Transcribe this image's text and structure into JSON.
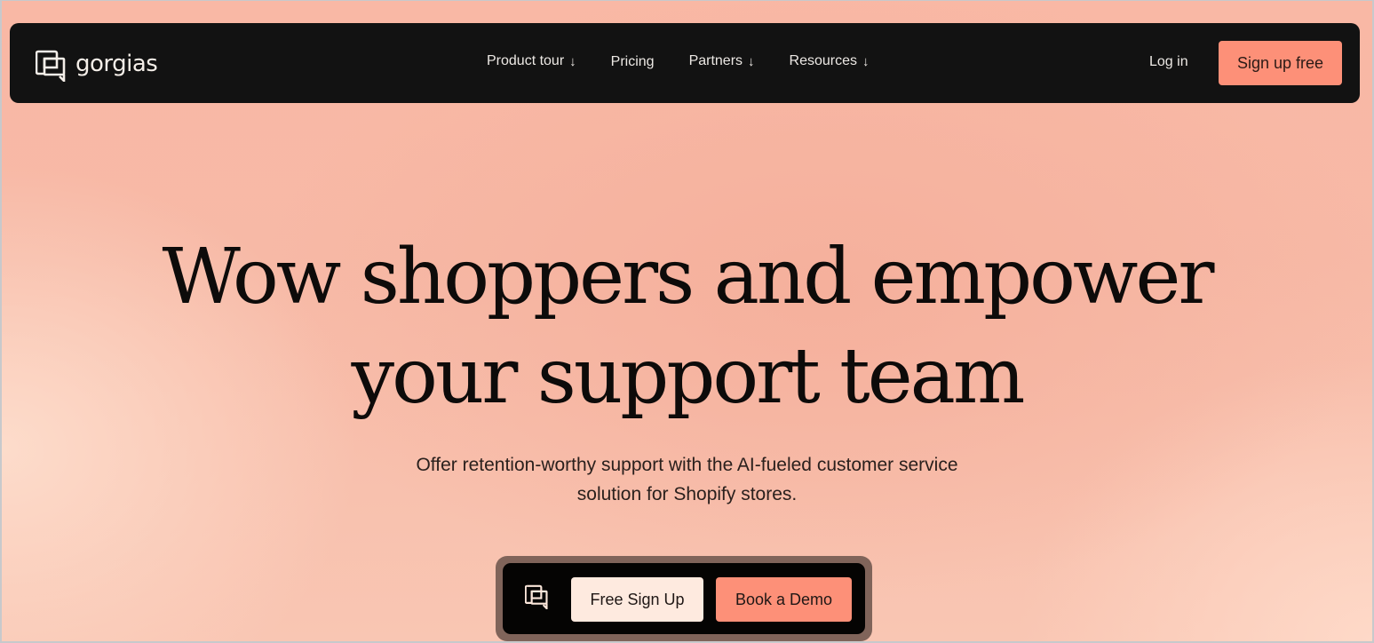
{
  "brand": {
    "name": "gorgias",
    "logo_icon": "gorgias-logo-icon"
  },
  "nav": {
    "items": [
      {
        "label": "Product tour",
        "has_dropdown": true,
        "icon": "arrow-down-icon",
        "arrow": "↓"
      },
      {
        "label": "Pricing",
        "has_dropdown": false
      },
      {
        "label": "Partners",
        "has_dropdown": true,
        "icon": "arrow-down-icon",
        "arrow": "↓"
      },
      {
        "label": "Resources",
        "has_dropdown": true,
        "icon": "arrow-down-icon",
        "arrow": "↓"
      }
    ],
    "login_label": "Log in",
    "signup_label": "Sign up free"
  },
  "hero": {
    "title_line1": "Wow shoppers and empower",
    "title_line2": "your support team",
    "subtitle_line1": "Offer retention-worthy support with the AI-fueled customer service",
    "subtitle_line2": "solution for Shopify stores."
  },
  "cta_bar": {
    "icon": "gorgias-logo-icon",
    "free_signup_label": "Free Sign Up",
    "book_demo_label": "Book a Demo"
  },
  "colors": {
    "nav_background": "#121212",
    "accent": "#fd9078",
    "cream": "#feeadf",
    "page_background": "#f7b9a6"
  }
}
